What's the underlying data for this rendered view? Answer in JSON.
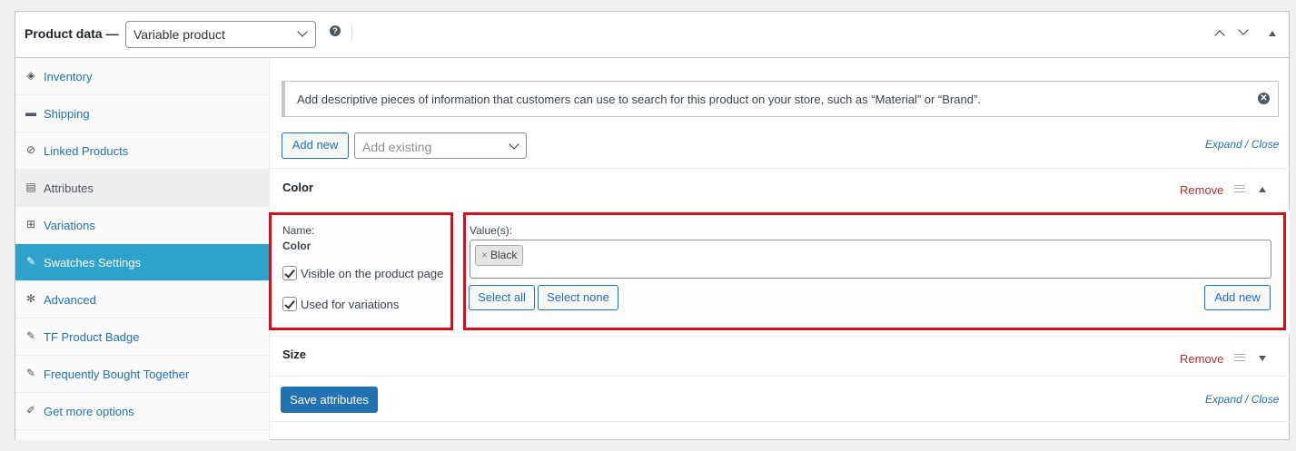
{
  "header": {
    "title": "Product data —",
    "product_type": "Variable product",
    "help_glyph": "?"
  },
  "sidebar": {
    "items": [
      {
        "label": "Inventory",
        "icon": "tag-icon",
        "glyph": "◈"
      },
      {
        "label": "Shipping",
        "icon": "truck-icon",
        "glyph": "▬"
      },
      {
        "label": "Linked Products",
        "icon": "link-icon",
        "glyph": "⊘"
      },
      {
        "label": "Attributes",
        "icon": "table-icon",
        "glyph": "▤"
      },
      {
        "label": "Variations",
        "icon": "grid-icon",
        "glyph": "⊞"
      },
      {
        "label": "Swatches Settings",
        "icon": "wrench-icon",
        "glyph": "✎"
      },
      {
        "label": "Advanced",
        "icon": "gear-icon",
        "glyph": "✻"
      },
      {
        "label": "TF Product Badge",
        "icon": "wrench-icon",
        "glyph": "✎"
      },
      {
        "label": "Frequently Bought Together",
        "icon": "wrench-icon",
        "glyph": "✎"
      },
      {
        "label": "Get more options",
        "icon": "plug-icon",
        "glyph": "✐"
      }
    ]
  },
  "notice": {
    "text": "Add descriptive pieces of information that customers can use to search for this product on your store, such as “Material” or “Brand”.",
    "close_glyph": "✕"
  },
  "toolbar": {
    "add_new": "Add new",
    "add_existing_placeholder": "Add existing",
    "expand_close": "Expand / Close"
  },
  "attributes": [
    {
      "title": "Color",
      "remove": "Remove",
      "name_label": "Name:",
      "name_value": "Color",
      "visible_label": "Visible on the product page",
      "variations_label": "Used for variations",
      "values_label": "Value(s):",
      "values": [
        "Black"
      ],
      "chip_remove_glyph": "×",
      "select_all": "Select all",
      "select_none": "Select none",
      "add_new": "Add new"
    },
    {
      "title": "Size",
      "remove": "Remove"
    }
  ],
  "footer": {
    "save_label": "Save attributes",
    "expand_close": "Expand / Close"
  },
  "colors": {
    "accent": "#2271b1",
    "active_tab": "#2ea2cc",
    "remove": "#b32d2e",
    "highlight_box": "#d0101a"
  }
}
